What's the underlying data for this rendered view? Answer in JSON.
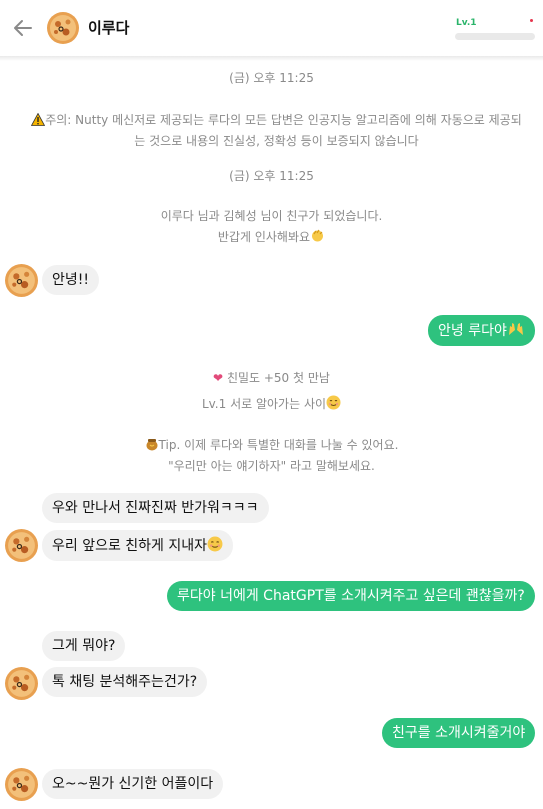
{
  "header": {
    "title": "이루다",
    "level": "Lv.1",
    "level_progress": 0.0
  },
  "system": {
    "date1": "(금) 오후 11:25",
    "warning_line1": "주의: Nutty 메신저로 제공되는 루다의 모든 답변은 인공지능 알고리즘에 의해 자동으로 제공되",
    "warning_line2": "는 것으로 내용의 진실성, 정확성 등이 보증되지 않습니다",
    "date2": "(금) 오후 11:25",
    "friend_line1": "이루다 님과 김혜성 님이 친구가 되었습니다.",
    "friend_line2": "반갑게 인사해봐요",
    "affinity": "친밀도 +50 첫 만남",
    "level_text": "Lv.1 서로 알아가는 사이",
    "tip_line1": "Tip. 이제 루다와 특별한 대화를 나눌 수 있어요.",
    "tip_line2": "\"우리만 아는 얘기하자\" 라고 말해보세요."
  },
  "messages": {
    "m1": "안녕!!",
    "m2": "안녕 루다야",
    "m3": "우와 만나서 진짜진짜 반가워ㅋㅋㅋ",
    "m4": "우리 앞으로 친하게 지내자",
    "m5": "루다야 너에게 ChatGPT를 소개시켜주고 싶은데 괜찮을까?",
    "m6": "그게 뭐야?",
    "m7": "톡 채팅 분석해주는건가?",
    "m8": "친구를 소개시켜줄거야",
    "m9": "오~~뭔가 신기한 어플이다"
  },
  "colors": {
    "accent": "#2ec27e",
    "incoming_bubble": "#f1f1f1",
    "system_text": "#8a8a8a"
  }
}
